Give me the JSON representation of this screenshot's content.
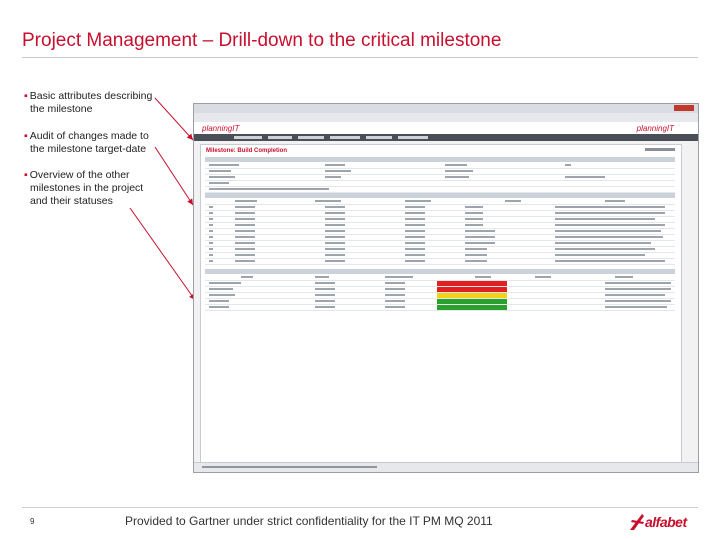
{
  "slide": {
    "title": "Project Management – Drill-down to the critical milestone",
    "bullets": [
      {
        "line1": "Basic attributes describing",
        "line2": "the milestone"
      },
      {
        "line1": "Audit of changes made to",
        "line2": "the milestone target-date"
      },
      {
        "line1": "Overview of the other",
        "line2": "milestones in the project",
        "line3": "and their statuses"
      }
    ],
    "page_number": "9",
    "footer": "Provided to Gartner under strict confidentiality for the IT PM MQ 2011",
    "brand": "alfabet"
  },
  "screenshot": {
    "app_logo": "planningIT",
    "brand_logo": "planningIT",
    "page_title": "Milestone: Build Completion",
    "status_colors": {
      "red": "#e02020",
      "yellow": "#f3d21a",
      "green": "#2aa12a"
    },
    "milestone_statuses": [
      "red",
      "red",
      "yellow",
      "green",
      "green"
    ]
  },
  "colors": {
    "accent": "#c8102e",
    "text": "#333333"
  }
}
